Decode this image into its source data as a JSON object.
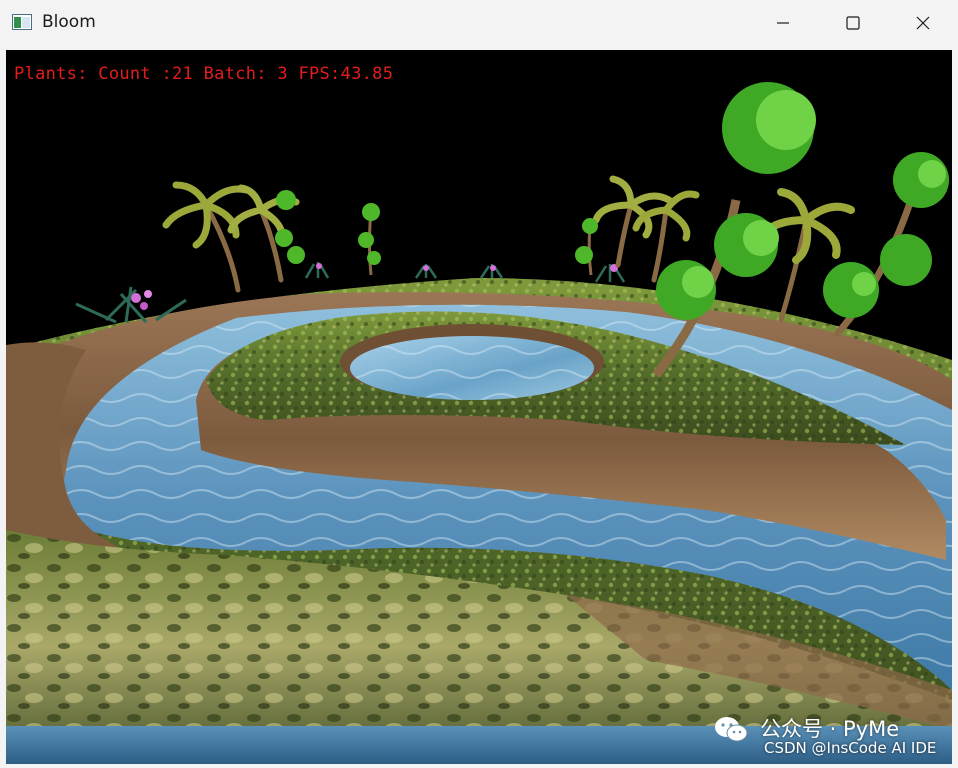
{
  "window": {
    "title": "Bloom",
    "icon": "app-window-icon",
    "controls": [
      "minimize-icon",
      "maximize-icon",
      "close-icon"
    ]
  },
  "hud": {
    "text": "Plants: Count :21 Batch: 3 FPS:43.85",
    "color": "#e31d1d"
  },
  "watermark": {
    "line1": "公众号 · PyMe",
    "line2": "CSDN @InsCode AI IDE",
    "logo": "wechat-icon"
  },
  "colors": {
    "sky": "#000000",
    "water": "#6fa4c8",
    "grass": "#5f7a2a",
    "cliff": "#8a6444"
  }
}
